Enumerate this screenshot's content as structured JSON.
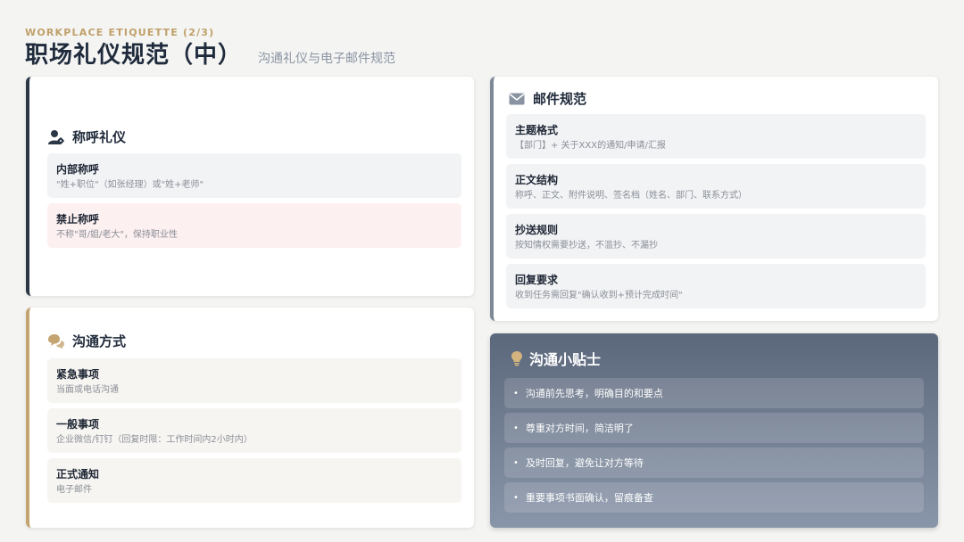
{
  "header": {
    "eyebrow": "WORKPLACE ETIQUETTE (2/3)",
    "title": "职场礼仪规范（中）",
    "subtitle": "沟通礼仪与电子邮件规范"
  },
  "address_card": {
    "title": "称呼礼仪",
    "icon": "user-tag-icon",
    "items": [
      {
        "label": "内部称呼",
        "desc": "\"姓+职位\"（如张经理）或\"姓+老师\"",
        "tone": "neutral"
      },
      {
        "label": "禁止称呼",
        "desc": "不称\"哥/姐/老大\"，保持职业性",
        "tone": "warning"
      }
    ]
  },
  "communication_card": {
    "title": "沟通方式",
    "icon": "chat-bubbles-icon",
    "items": [
      {
        "label": "紧急事项",
        "desc": "当面或电话沟通"
      },
      {
        "label": "一般事项",
        "desc": "企业微信/钉钉（回复时限：工作时间内2小时内）"
      },
      {
        "label": "正式通知",
        "desc": "电子邮件"
      }
    ]
  },
  "email_card": {
    "title": "邮件规范",
    "icon": "envelope-icon",
    "items": [
      {
        "label": "主题格式",
        "desc": "【部门】+ 关于XXX的通知/申请/汇报"
      },
      {
        "label": "正文结构",
        "desc": "称呼、正文、附件说明、签名档（姓名、部门、联系方式）"
      },
      {
        "label": "抄送规则",
        "desc": "按知情权需要抄送，不滥抄、不漏抄"
      },
      {
        "label": "回复要求",
        "desc": "收到任务需回复\"确认收到+预计完成时间\""
      }
    ]
  },
  "tips_card": {
    "title": "沟通小贴士",
    "icon": "lightbulb-icon",
    "items": [
      "沟通前先思考，明确目的和要点",
      "尊重对方时间，简洁明了",
      "及时回复，避免让对方等待",
      "重要事项书面确认，留痕备查"
    ]
  },
  "colors": {
    "accent_gold": "#c4a470",
    "navy": "#2b3646",
    "warning_bg": "#fdf0f0",
    "tips_gradient_top": "#5b677b",
    "tips_gradient_bottom": "#8995a9"
  }
}
